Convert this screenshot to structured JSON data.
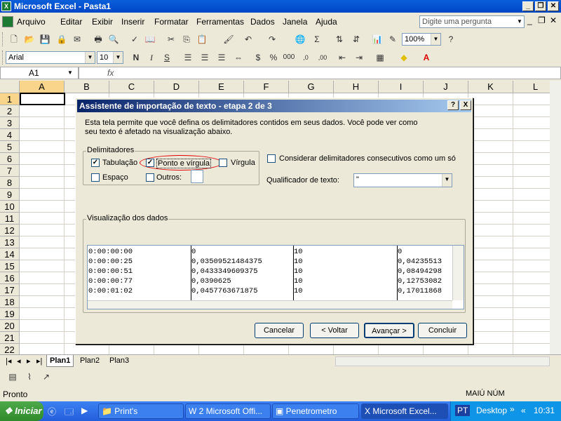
{
  "window": {
    "title": "Microsoft Excel - Pasta1"
  },
  "menu": [
    "Arquivo",
    "Editar",
    "Exibir",
    "Inserir",
    "Formatar",
    "Ferramentas",
    "Dados",
    "Janela",
    "Ajuda"
  ],
  "ask_placeholder": "Digite uma pergunta",
  "toolbar": {
    "zoom": "100%",
    "font": "Arial",
    "size": "10",
    "bold": "N",
    "italic": "I",
    "underline": "S"
  },
  "namebox": "A1",
  "fx": "fx",
  "columns": [
    "A",
    "B",
    "C",
    "D",
    "E",
    "F",
    "G",
    "H",
    "I",
    "J",
    "K",
    "L"
  ],
  "rows": [
    "1",
    "2",
    "3",
    "4",
    "5",
    "6",
    "7",
    "8",
    "9",
    "10",
    "11",
    "12",
    "13",
    "14",
    "15",
    "16",
    "17",
    "18",
    "19",
    "20",
    "21",
    "22"
  ],
  "sheets": [
    "Plan1",
    "Plan2",
    "Plan3"
  ],
  "status": {
    "left": "Pronto",
    "right": "MAIÚ NÚM"
  },
  "taskbar": {
    "start": "Iniciar",
    "items": [
      "Print's",
      "2 Microsoft Offi...",
      "Penetrometro",
      "Microsoft Excel..."
    ],
    "lang": "PT",
    "desktop": "Desktop",
    "clock": "10:31"
  },
  "dialog": {
    "title": "Assistente de importação de texto - etapa 2 de 3",
    "help": "?",
    "close": "X",
    "desc1": "Esta tela permite que você defina os delimitadores contidos em seus dados. Você pode ver como",
    "desc2": "seu texto é afetado na visualização abaixo.",
    "delim_group": "Delimitadores",
    "tab": "Tabulação",
    "semicolon": "Ponto e vírgula",
    "comma": "Vírgula",
    "space": "Espaço",
    "others": "Outros:",
    "consecutive": "Considerar delimitadores consecutivos como um só",
    "qualifier_label": "Qualificador de texto:",
    "qualifier_value": "\"",
    "preview_group": "Visualização dos dados",
    "buttons": {
      "cancel": "Cancelar",
      "back": "< Voltar",
      "next": "Avançar >",
      "finish": "Concluir"
    },
    "preview_rows": [
      [
        "0:00:00:00",
        "0",
        "10",
        "0"
      ],
      [
        "0:00:00:25",
        "0,03509521484375",
        "10",
        "0,04235513"
      ],
      [
        "0:00:00:51",
        "0,0433349609375",
        "10",
        "0,08494298"
      ],
      [
        "0:00:00:77",
        "0,0390625",
        "10",
        "0,12753082"
      ],
      [
        "0:00:01:02",
        "0,0457763671875",
        "10",
        "0,17011868"
      ]
    ]
  }
}
